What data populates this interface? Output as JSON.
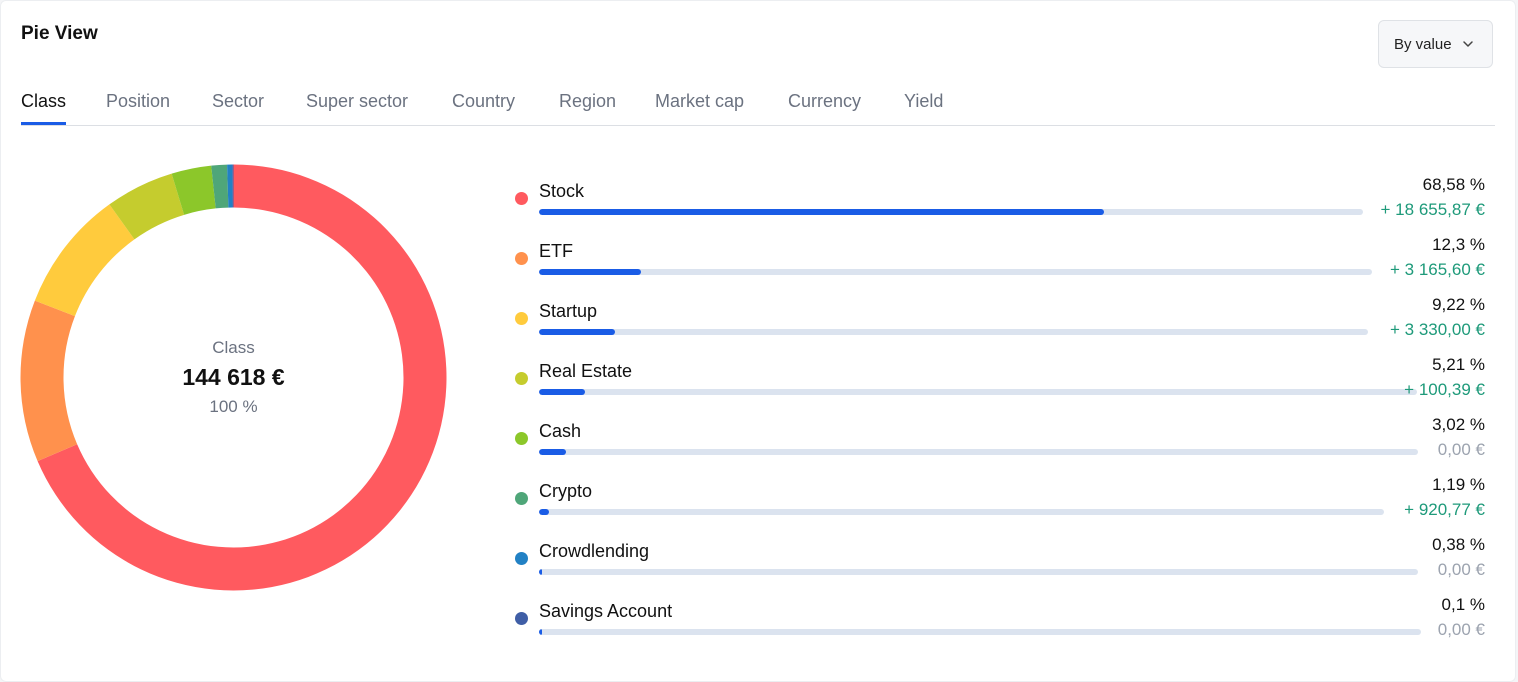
{
  "header": {
    "title": "Pie View",
    "sort_dropdown": {
      "selected": "By value"
    }
  },
  "tabs": [
    {
      "label": "Class",
      "active": true
    },
    {
      "label": "Position",
      "active": false
    },
    {
      "label": "Sector",
      "active": false
    },
    {
      "label": "Super sector",
      "active": false
    },
    {
      "label": "Country",
      "active": false
    },
    {
      "label": "Region",
      "active": false
    },
    {
      "label": "Market cap",
      "active": false
    },
    {
      "label": "Currency",
      "active": false
    },
    {
      "label": "Yield",
      "active": false
    }
  ],
  "donut": {
    "label": "Class",
    "total": "144 618 €",
    "percent": "100 %"
  },
  "colors": {
    "accent": "#1a5ce6",
    "gain": "#1e9a7a",
    "neutral": "#9ca3af"
  },
  "chart_data": {
    "type": "pie",
    "categories": [
      "Stock",
      "ETF",
      "Startup",
      "Real Estate",
      "Cash",
      "Crypto",
      "Crowdlending",
      "Savings Account"
    ],
    "values": [
      68.58,
      12.3,
      9.22,
      5.21,
      3.02,
      1.19,
      0.38,
      0.1
    ],
    "colors": [
      "#ff5a5f",
      "#ff914d",
      "#ffcb3d",
      "#c5cc2e",
      "#8cc72a",
      "#4fa679",
      "#2281c4",
      "#3f5ea6"
    ],
    "title": ""
  },
  "legend": [
    {
      "name": "Stock",
      "percent_label": "68,58 %",
      "gain": "+ 18 655,87 €",
      "gain_positive": true,
      "fraction": 0.6858
    },
    {
      "name": "ETF",
      "percent_label": "12,3 %",
      "gain": "+ 3 165,60 €",
      "gain_positive": true,
      "fraction": 0.123
    },
    {
      "name": "Startup",
      "percent_label": "9,22 %",
      "gain": "+ 3 330,00 €",
      "gain_positive": true,
      "fraction": 0.0922
    },
    {
      "name": "Real Estate",
      "percent_label": "5,21 %",
      "gain": "+ 100,39 €",
      "gain_positive": true,
      "fraction": 0.0521
    },
    {
      "name": "Cash",
      "percent_label": "3,02 %",
      "gain": "0,00 €",
      "gain_positive": false,
      "fraction": 0.0302
    },
    {
      "name": "Crypto",
      "percent_label": "1,19 %",
      "gain": "+ 920,77 €",
      "gain_positive": true,
      "fraction": 0.0119
    },
    {
      "name": "Crowdlending",
      "percent_label": "0,38 %",
      "gain": "0,00 €",
      "gain_positive": false,
      "fraction": 0.0038
    },
    {
      "name": "Savings Account",
      "percent_label": "0,1 %",
      "gain": "0,00 €",
      "gain_positive": false,
      "fraction": 0.001
    }
  ]
}
